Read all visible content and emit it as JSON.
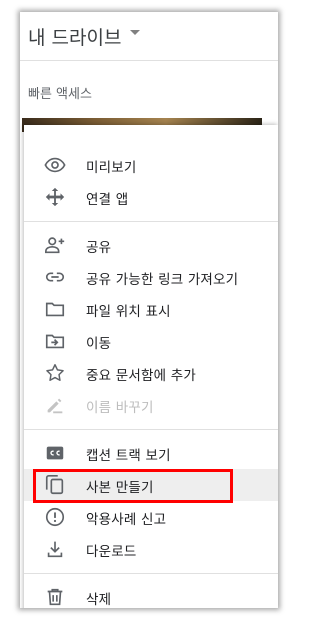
{
  "header": {
    "title": "내 드라이브"
  },
  "section": {
    "quick_access": "빠른 액세스"
  },
  "menu": {
    "items": [
      {
        "label": "미리보기",
        "icon": "eye-icon"
      },
      {
        "label": "연결 앱",
        "icon": "move-arrows-icon"
      },
      {
        "label": "공유",
        "icon": "add-person-icon"
      },
      {
        "label": "공유 가능한 링크 가져오기",
        "icon": "link-icon"
      },
      {
        "label": "파일 위치 표시",
        "icon": "folder-icon"
      },
      {
        "label": "이동",
        "icon": "move-to-folder-icon"
      },
      {
        "label": "중요 문서함에 추가",
        "icon": "star-icon"
      },
      {
        "label": "이름 바꾸기",
        "icon": "pencil-icon"
      },
      {
        "label": "캡션 트랙 보기",
        "icon": "closed-caption-icon"
      },
      {
        "label": "사본 만들기",
        "icon": "copy-icon"
      },
      {
        "label": "악용사례 신고",
        "icon": "alert-circle-icon"
      },
      {
        "label": "다운로드",
        "icon": "download-icon"
      },
      {
        "label": "삭제",
        "icon": "trash-icon"
      }
    ],
    "disabled_item": "이름 바꾸기",
    "highlighted_item": "사본 만들기",
    "annotation_color": "#ff0000"
  }
}
